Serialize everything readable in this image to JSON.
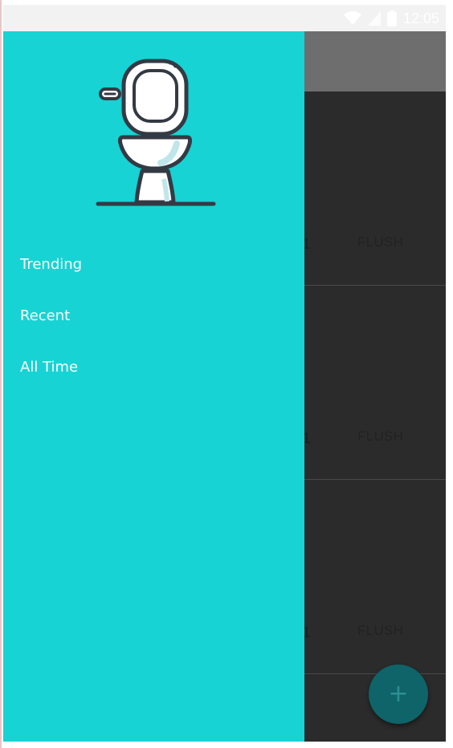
{
  "status_bar": {
    "time": "12:05",
    "icons": [
      "wifi-icon",
      "signal-icon",
      "battery-icon"
    ]
  },
  "drawer": {
    "logo": "toilet-icon",
    "menu_items": [
      {
        "label": "Trending"
      },
      {
        "label": "Recent"
      },
      {
        "label": "All Time"
      }
    ]
  },
  "feed": {
    "cards": [
      {
        "count": "1",
        "action_label": "FLUSH"
      },
      {
        "count": "1",
        "action_label": "FLUSH"
      },
      {
        "count": "1",
        "action_label": "FLUSH"
      }
    ]
  },
  "fab": {
    "label": "+",
    "icon": "plus-icon"
  },
  "colors": {
    "drawer_background": "#17d3d4",
    "scrim": "#2b2b2b",
    "fab": "#0e6468",
    "logo_stroke": "#343a44"
  }
}
